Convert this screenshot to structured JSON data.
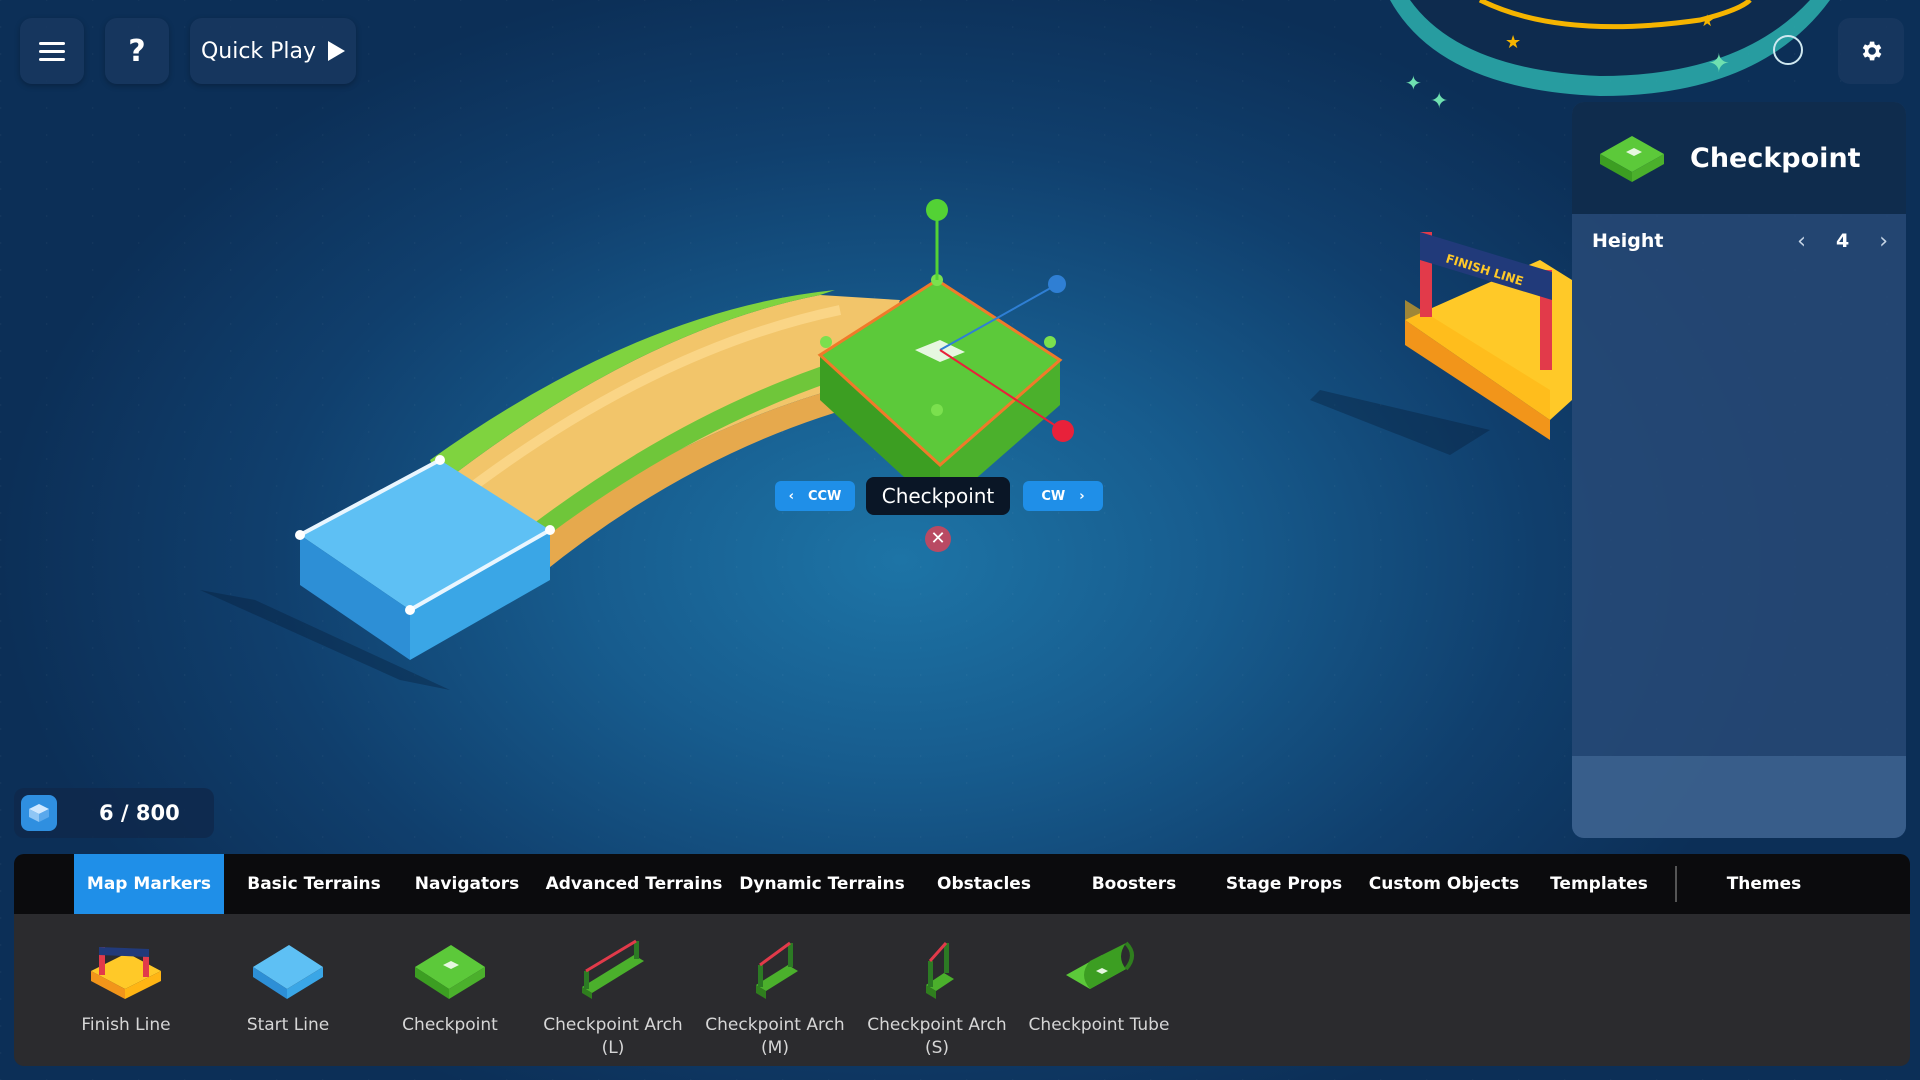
{
  "toolbar": {
    "menu_icon": "hamburger-icon",
    "help_label": "?",
    "quick_play_label": "Quick Play",
    "settings_icon": "gear-icon"
  },
  "properties_panel": {
    "title": "Checkpoint",
    "height_label": "Height",
    "height_value": "4"
  },
  "selection": {
    "label": "Checkpoint",
    "ccw_label": "CCW",
    "cw_label": "CW"
  },
  "counter": {
    "text": "6 / 800",
    "used": 6,
    "max": 800
  },
  "tabs": [
    {
      "label": "Map Markers",
      "active": true
    },
    {
      "label": "Basic Terrains",
      "active": false
    },
    {
      "label": "Navigators",
      "active": false
    },
    {
      "label": "Advanced Terrains",
      "active": false
    },
    {
      "label": "Dynamic Terrains",
      "active": false
    },
    {
      "label": "Obstacles",
      "active": false
    },
    {
      "label": "Boosters",
      "active": false
    },
    {
      "label": "Stage Props",
      "active": false
    },
    {
      "label": "Custom Objects",
      "active": false
    },
    {
      "label": "Templates",
      "active": false
    },
    {
      "label": "Themes",
      "active": false
    }
  ],
  "items": [
    {
      "line1": "Finish Line",
      "line2": ""
    },
    {
      "line1": "Start Line",
      "line2": ""
    },
    {
      "line1": "Checkpoint",
      "line2": ""
    },
    {
      "line1": "Checkpoint Arch",
      "line2": "(L)"
    },
    {
      "line1": "Checkpoint Arch",
      "line2": "(M)"
    },
    {
      "line1": "Checkpoint Arch",
      "line2": "(S)"
    },
    {
      "line1": "Checkpoint Tube",
      "line2": ""
    }
  ],
  "scene": {
    "finish_banner_text": "FINISH LINE"
  },
  "colors": {
    "accent": "#1f8fe8",
    "grass": "#5cc93a",
    "start": "#4fb6f0",
    "finish": "#ffc928",
    "handle_green": "#53d235",
    "handle_red": "#e8213a",
    "handle_blue": "#2f7fd4"
  }
}
